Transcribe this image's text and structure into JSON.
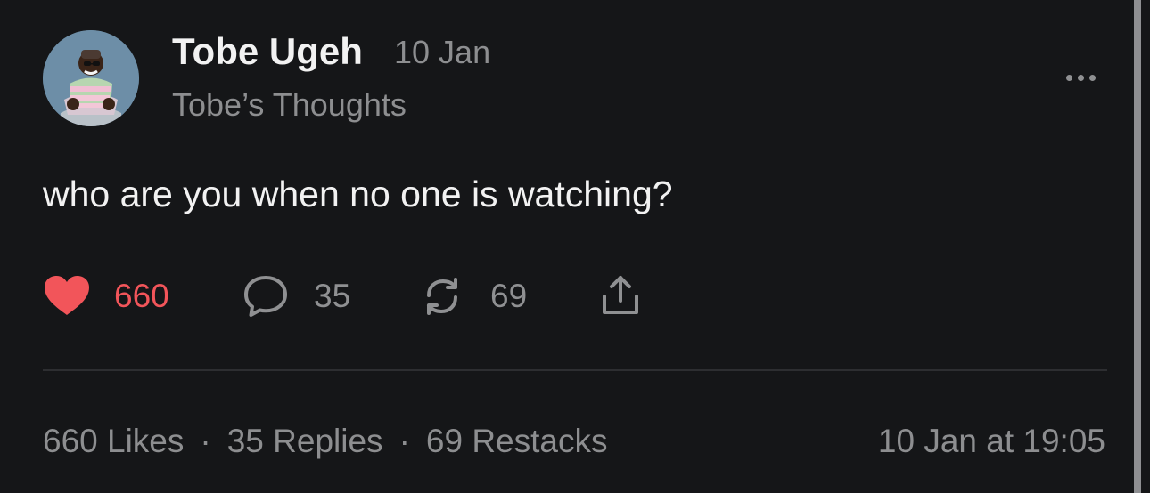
{
  "author": {
    "name": "Tobe Ugeh",
    "date": "10 Jan",
    "publication": "Tobe’s Thoughts",
    "avatar": "avatar-photo"
  },
  "post": {
    "text": "who are you when no one is watching?"
  },
  "actions": {
    "like_count": "660",
    "reply_count": "35",
    "restack_count": "69",
    "like_icon": "heart-icon",
    "reply_icon": "speech-bubble-icon",
    "restack_icon": "restack-icon",
    "share_icon": "share-icon",
    "more_icon": "more-dots-icon"
  },
  "stats": {
    "likes": "660 Likes",
    "separator_1": "·",
    "replies": "35 Replies",
    "separator_2": "·",
    "restacks": "69 Restacks",
    "timestamp": "10 Jan at 19:05"
  },
  "colors": {
    "background": "#151618",
    "primary_text": "#f2f2f2",
    "secondary_text": "#8d8e90",
    "like_red": "#f2555a",
    "divider": "#2d2e31"
  }
}
